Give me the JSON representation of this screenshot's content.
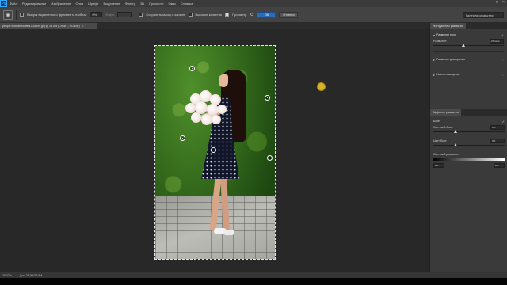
{
  "menubar": {
    "logo": "Ps",
    "items": [
      "Файл",
      "Редактирование",
      "Изображение",
      "Слои",
      "Шрифт",
      "Выделение",
      "Фильтр",
      "3D",
      "Просмотр",
      "Окно",
      "Справка"
    ]
  },
  "options": {
    "field1_label": "Выпуск выделенного фрагмента в образ",
    "field1_value": "0%",
    "field2_label": "Фокус",
    "field3_label": "Сохранить маску в канале",
    "field4_label": "Высокое качество",
    "preview_label": "Просмотр",
    "ok_label": "ОК",
    "cancel_label": "Отмена",
    "workspace": "Галерея размытия"
  },
  "document": {
    "tab_title": "people-woman-flowers-825190.jpg @ 25.4% (Слой 1, RGB/8*)",
    "close": "×"
  },
  "panel": {
    "tabs": [
      "Инструменты размытия"
    ],
    "section1": {
      "title": "Размытие поля",
      "param_label": "Размытие:",
      "param_value": "27 пикс."
    },
    "section2": {
      "title": "Размытие диафрагмы"
    },
    "section3": {
      "title": "Наклон-смещение"
    },
    "effects_tab": "Эффекты размытия",
    "effects": {
      "title": "Боке",
      "light_bokeh_label": "Световой боке:",
      "light_bokeh_value": "0%",
      "color_bokeh_label": "Цвет боке:",
      "color_bokeh_value": "0%",
      "light_range_label": "Световой диапазон:",
      "range_min": "0%",
      "range_max": "0%"
    }
  },
  "status": {
    "zoom": "25.37%",
    "doc": "Док: 25,9M/28,8M"
  },
  "colors": {
    "accent_ok": "#2d6db5",
    "canvas_bg": "#282828",
    "panel_bg": "#3a3a3a"
  }
}
